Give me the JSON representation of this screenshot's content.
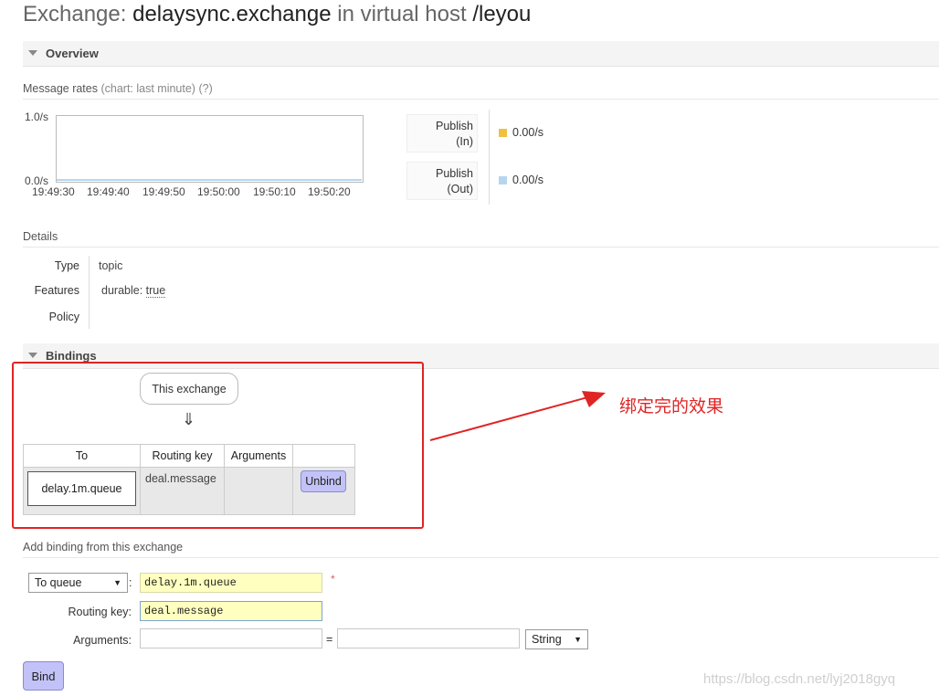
{
  "title": {
    "prefix": "Exchange:",
    "exchange_name": "delaysync.exchange",
    "mid": "in virtual host",
    "vhost": "/leyou"
  },
  "overview": {
    "header": "Overview",
    "message_rates_label": "Message rates",
    "chart_hint": "(chart: last minute)",
    "help": "(?)",
    "y_max": "1.0/s",
    "y_min": "0.0/s",
    "x_ticks": [
      "19:49:30",
      "19:49:40",
      "19:49:50",
      "19:50:00",
      "19:50:10",
      "19:50:20"
    ],
    "publish_in": {
      "line1": "Publish",
      "line2": "(In)",
      "value": "0.00/s",
      "color": "#f0c040"
    },
    "publish_out": {
      "line1": "Publish",
      "line2": "(Out)",
      "value": "0.00/s",
      "color": "#b5d6ef"
    }
  },
  "details": {
    "header": "Details",
    "type_label": "Type",
    "type_value": "topic",
    "features_label": "Features",
    "features_key": "durable:",
    "features_value": "true",
    "policy_label": "Policy"
  },
  "bindings": {
    "header": "Bindings",
    "source": "This exchange",
    "arrow": "⇓",
    "columns": {
      "to": "To",
      "routing_key": "Routing key",
      "arguments": "Arguments"
    },
    "rows": [
      {
        "to": "delay.1m.queue",
        "routing_key": "deal.message",
        "arguments": "",
        "unbind_label": "Unbind"
      }
    ]
  },
  "annotation": "绑定完的效果",
  "add_binding": {
    "header": "Add binding from this exchange",
    "dest_type": "To queue",
    "dest_name": "delay.1m.queue",
    "required_mark": "*",
    "routing_key_label": "Routing key:",
    "routing_key_value": "deal.message",
    "arguments_label": "Arguments:",
    "args_key": "",
    "equals": "=",
    "args_value": "",
    "arg_type": "String",
    "bind_label": "Bind"
  },
  "watermark": "https://blog.csdn.net/lyj2018gyq",
  "colors": {
    "annotation_red": "#e02424",
    "button_purple": "#c2c2f8",
    "required_yellow": "#ffffc0"
  }
}
